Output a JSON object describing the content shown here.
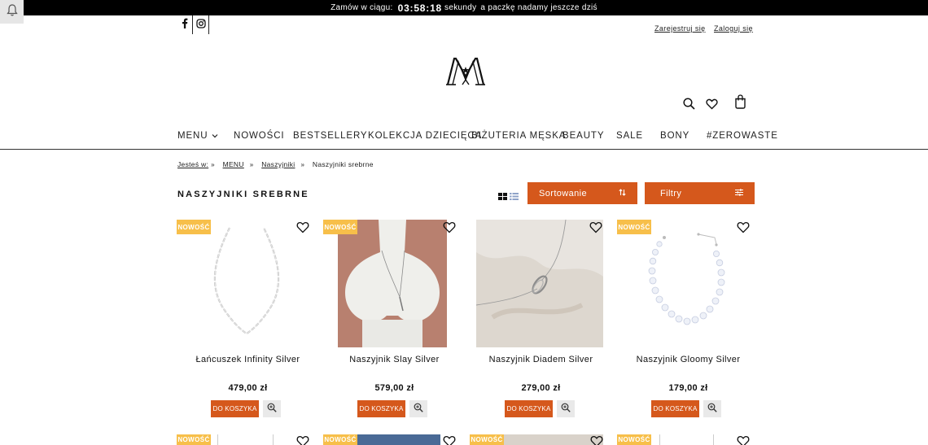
{
  "notice": {
    "before": "Zamów w ciągu:",
    "timer": "03:58:18",
    "after": "sekundy",
    "after2": "a paczkę nadamy jeszcze dziś"
  },
  "account": {
    "register": "Zarejestruj się",
    "login": "Zaloguj się"
  },
  "nav": [
    {
      "label": "MENU"
    },
    {
      "label": "NOWOŚCI"
    },
    {
      "label": "BESTSELLERY"
    },
    {
      "label": "KOLEKCJA DZIECIĘCA"
    },
    {
      "label": "BIŻUTERIA MĘSKA"
    },
    {
      "label": "BEAUTY"
    },
    {
      "label": "SALE"
    },
    {
      "label": "BONY"
    },
    {
      "label": "#ZEROWASTE"
    }
  ],
  "breadcrumb": {
    "prefix": "Jesteś w:",
    "items": [
      "MENU",
      "Naszyjniki",
      "Naszyjniki srebrne"
    ]
  },
  "page_title": "NASZYJNIKI SREBRNE",
  "sort_label": "Sortowanie",
  "filter_label": "Filtry",
  "badge_label": "NOWOŚĆ",
  "cart_label": "DO KOSZYKA",
  "products": [
    {
      "name": "Łańcuszek Infinity Silver",
      "price": "479,00 zł",
      "badge": true
    },
    {
      "name": "Naszyjnik Slay Silver",
      "price": "579,00 zł",
      "badge": true
    },
    {
      "name": "Naszyjnik Diadem Silver",
      "price": "279,00 zł",
      "badge": false
    },
    {
      "name": "Naszyjnik Gloomy Silver",
      "price": "179,00 zł",
      "badge": true
    }
  ],
  "icons": {
    "bell": "bell-icon",
    "facebook": "facebook-icon",
    "instagram": "instagram-icon",
    "search": "search-icon",
    "wishlist": "heart-icon",
    "cart": "bag-icon",
    "grid": "grid-view-icon",
    "list": "list-view-icon",
    "sort": "sort-icon",
    "filter": "sliders-icon",
    "zoom": "zoom-icon"
  },
  "colors": {
    "accent": "#d5581c",
    "badge": "#f7bf4a",
    "topbar": "#000000"
  }
}
